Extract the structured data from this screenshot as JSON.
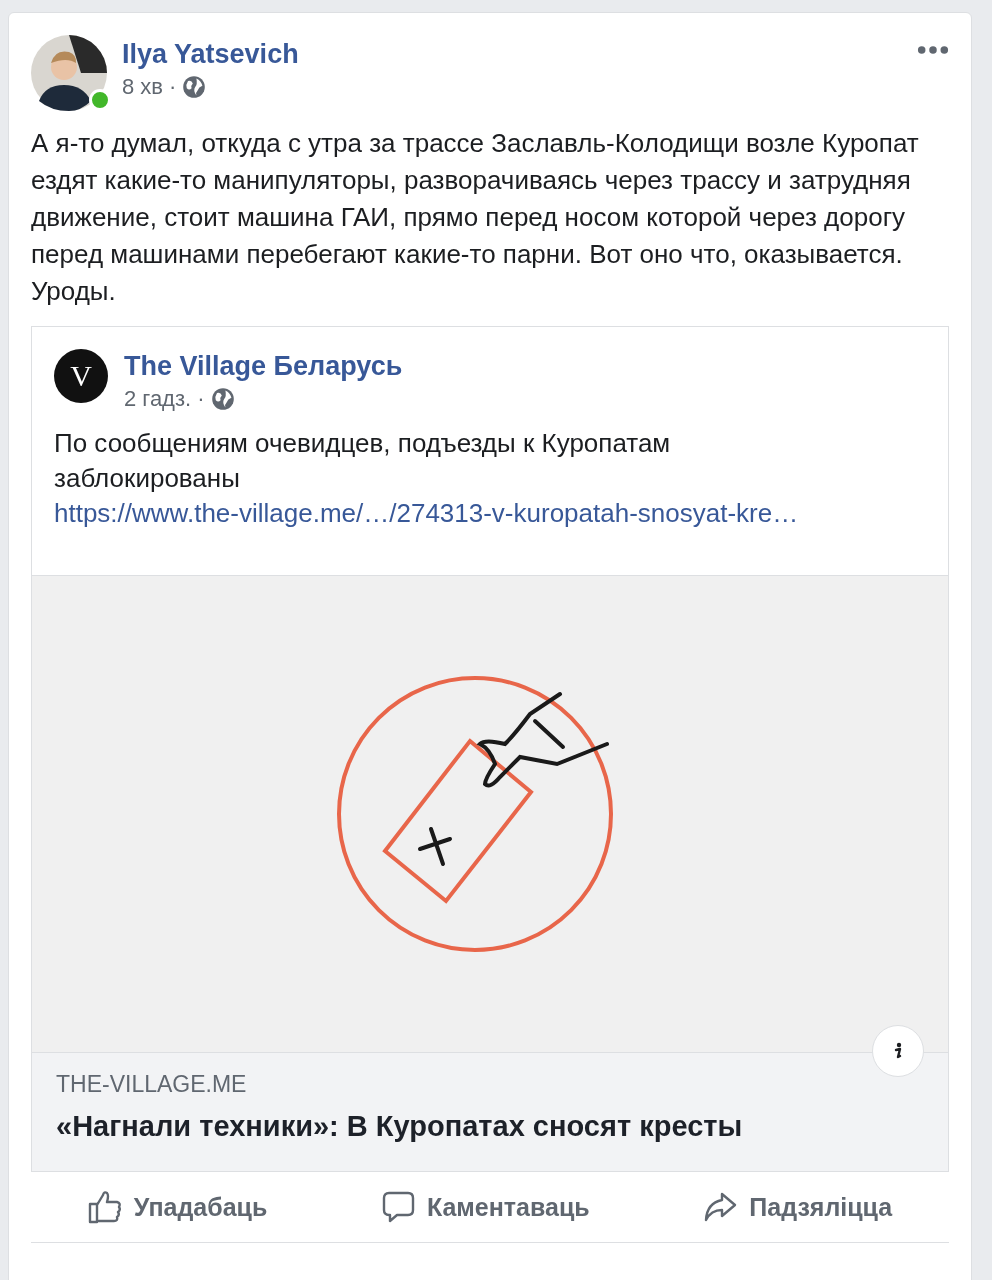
{
  "post": {
    "author": "Ilya Yatsevich",
    "online": true,
    "time": "8 хв",
    "separator": "·",
    "text": "А я-то думал, откуда с утра за трассе Заславль-Колодищи возле Куропат ездят какие-то манипуляторы, разворачиваясь через трассу и затрудняя движение, стоит машина ГАИ, прямо перед носом которой через дорогу перед машинами перебегают какие-то парни. Вот оно что, оказывается. Уроды."
  },
  "shared": {
    "page": "The Village Беларусь",
    "logo_letter": "V",
    "time": "2 гадз.",
    "separator": "·",
    "text": "По сообщениям очевидцев, подъезды к Куропатам заблокированы",
    "link": "https://www.the-village.me/…/274313-v-kuropatah-snosyat-kre…",
    "preview": {
      "domain": "THE-VILLAGE.ME",
      "title": "«Нагнали техники»: В Куропатах сносят кресты"
    }
  },
  "actions": [
    {
      "kind": "like",
      "label": "Упадабаць"
    },
    {
      "kind": "comment",
      "label": "Каментаваць"
    },
    {
      "kind": "share",
      "label": "Падзяліцца"
    }
  ]
}
